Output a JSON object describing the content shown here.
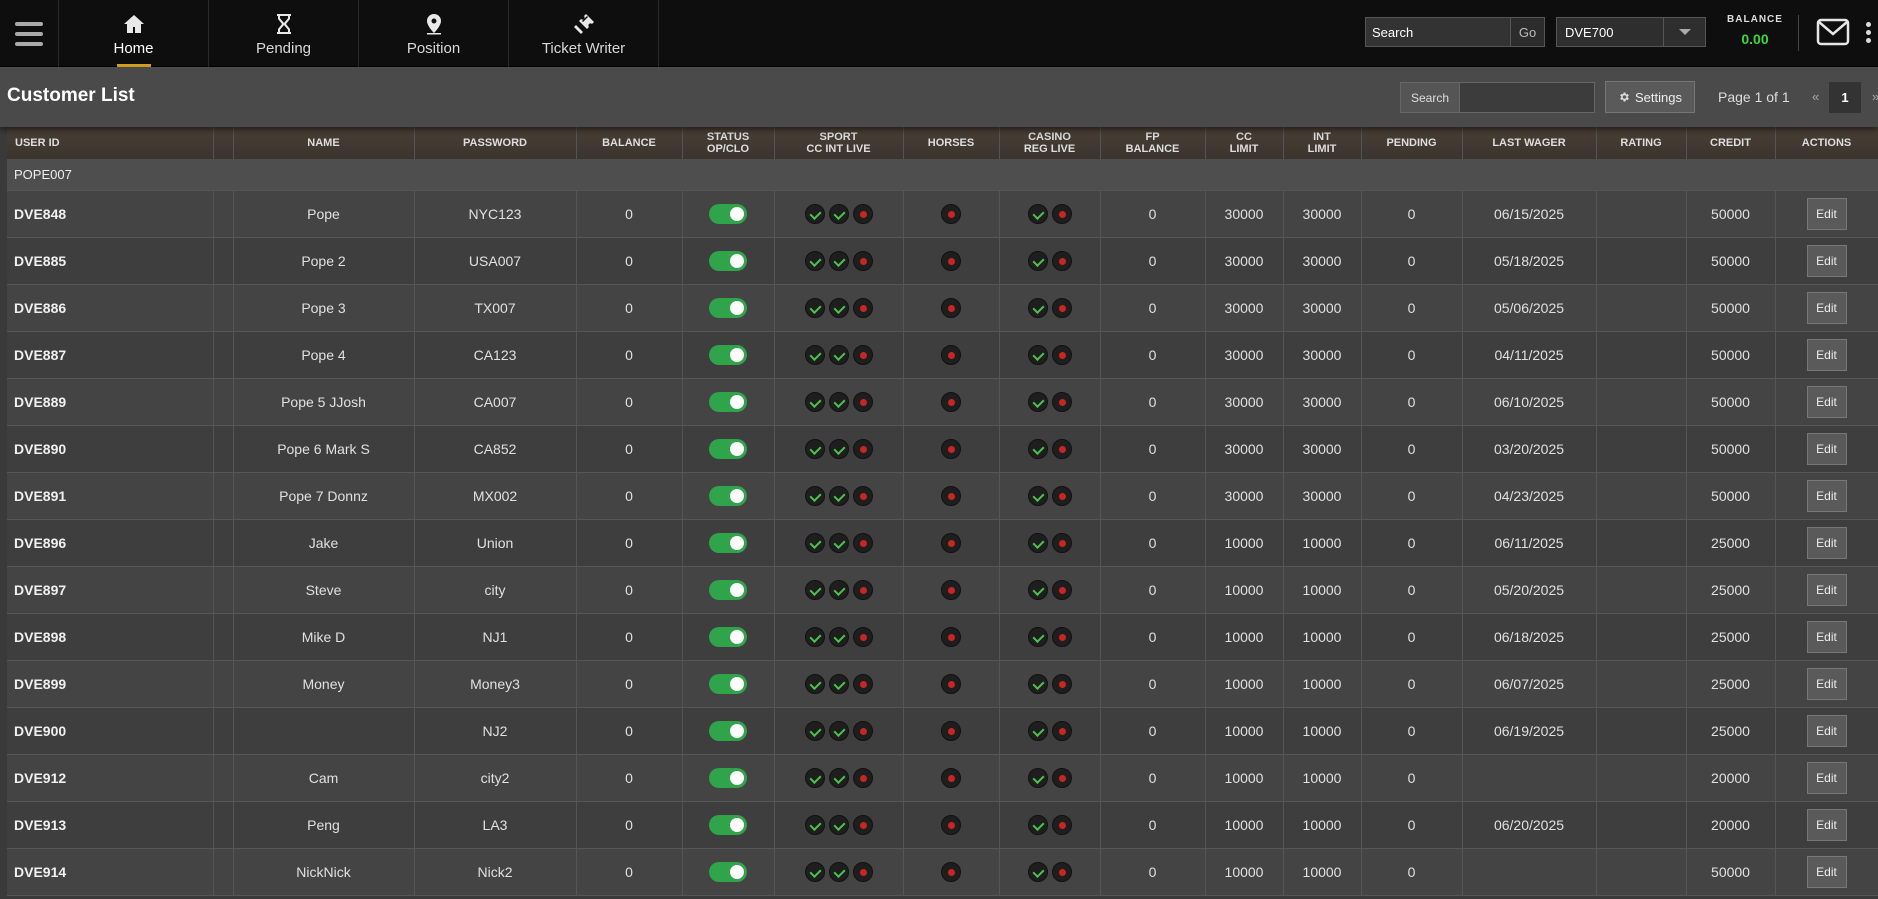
{
  "nav": {
    "tabs": [
      {
        "label": "Home",
        "icon": "home-icon"
      },
      {
        "label": "Pending",
        "icon": "hourglass-icon"
      },
      {
        "label": "Position",
        "icon": "map-pin-icon"
      },
      {
        "label": "Ticket Writer",
        "icon": "ticket-icon"
      }
    ],
    "active_tab": "Home",
    "search_value": "Search",
    "go_label": "Go",
    "account_selected": "DVE700",
    "balance_label": "BALANCE",
    "balance_value": "0.00"
  },
  "colors": {
    "accent": "#d9a321",
    "balance": "#3fd63f",
    "toggle_on": "#2fa44a",
    "check": "#4cc24c",
    "cross": "#c92525"
  },
  "titlebar": {
    "title": "Customer List",
    "search_label": "Search",
    "search_value": "",
    "settings_label": "Settings",
    "page_info": "Page 1 of 1",
    "prev": "«",
    "current_page": "1",
    "next": "»"
  },
  "table": {
    "headers": [
      "USER ID",
      "",
      "NAME",
      "PASSWORD",
      "BALANCE",
      "STATUS\nOP/CLO",
      "SPORT\nCC INT LIVE",
      "HORSES",
      "CASINO\nREG LIVE",
      "FP\nBALANCE",
      "CC\nLIMIT",
      "INT\nLIMIT",
      "PENDING",
      "LAST WAGER",
      "RATING",
      "CREDIT",
      "ACTIONS"
    ],
    "group": "POPE007",
    "edit_label": "Edit",
    "rows": [
      {
        "uid": "DVE848",
        "name": "Pope",
        "password": "NYC123",
        "balance": "0",
        "fp": "0",
        "cc": "30000",
        "int": "30000",
        "pending": "0",
        "last": "06/15/2025",
        "rating": "",
        "credit": "50000"
      },
      {
        "uid": "DVE885",
        "name": "Pope 2",
        "password": "USA007",
        "balance": "0",
        "fp": "0",
        "cc": "30000",
        "int": "30000",
        "pending": "0",
        "last": "05/18/2025",
        "rating": "",
        "credit": "50000"
      },
      {
        "uid": "DVE886",
        "name": "Pope 3",
        "password": "TX007",
        "balance": "0",
        "fp": "0",
        "cc": "30000",
        "int": "30000",
        "pending": "0",
        "last": "05/06/2025",
        "rating": "",
        "credit": "50000"
      },
      {
        "uid": "DVE887",
        "name": "Pope 4",
        "password": "CA123",
        "balance": "0",
        "fp": "0",
        "cc": "30000",
        "int": "30000",
        "pending": "0",
        "last": "04/11/2025",
        "rating": "",
        "credit": "50000"
      },
      {
        "uid": "DVE889",
        "name": "Pope 5 JJosh",
        "password": "CA007",
        "balance": "0",
        "fp": "0",
        "cc": "30000",
        "int": "30000",
        "pending": "0",
        "last": "06/10/2025",
        "rating": "",
        "credit": "50000"
      },
      {
        "uid": "DVE890",
        "name": "Pope 6 Mark S",
        "password": "CA852",
        "balance": "0",
        "fp": "0",
        "cc": "30000",
        "int": "30000",
        "pending": "0",
        "last": "03/20/2025",
        "rating": "",
        "credit": "50000"
      },
      {
        "uid": "DVE891",
        "name": "Pope 7 Donnz",
        "password": "MX002",
        "balance": "0",
        "fp": "0",
        "cc": "30000",
        "int": "30000",
        "pending": "0",
        "last": "04/23/2025",
        "rating": "",
        "credit": "50000"
      },
      {
        "uid": "DVE896",
        "name": "Jake",
        "password": "Union",
        "balance": "0",
        "fp": "0",
        "cc": "10000",
        "int": "10000",
        "pending": "0",
        "last": "06/11/2025",
        "rating": "",
        "credit": "25000"
      },
      {
        "uid": "DVE897",
        "name": "Steve",
        "password": "city",
        "balance": "0",
        "fp": "0",
        "cc": "10000",
        "int": "10000",
        "pending": "0",
        "last": "05/20/2025",
        "rating": "",
        "credit": "25000"
      },
      {
        "uid": "DVE898",
        "name": "Mike D",
        "password": "NJ1",
        "balance": "0",
        "fp": "0",
        "cc": "10000",
        "int": "10000",
        "pending": "0",
        "last": "06/18/2025",
        "rating": "",
        "credit": "25000"
      },
      {
        "uid": "DVE899",
        "name": "Money",
        "password": "Money3",
        "balance": "0",
        "fp": "0",
        "cc": "10000",
        "int": "10000",
        "pending": "0",
        "last": "06/07/2025",
        "rating": "",
        "credit": "25000"
      },
      {
        "uid": "DVE900",
        "name": "",
        "password": "NJ2",
        "balance": "0",
        "fp": "0",
        "cc": "10000",
        "int": "10000",
        "pending": "0",
        "last": "06/19/2025",
        "rating": "",
        "credit": "25000"
      },
      {
        "uid": "DVE912",
        "name": "Cam",
        "password": "city2",
        "balance": "0",
        "fp": "0",
        "cc": "10000",
        "int": "10000",
        "pending": "0",
        "last": "",
        "rating": "",
        "credit": "20000"
      },
      {
        "uid": "DVE913",
        "name": "Peng",
        "password": "LA3",
        "balance": "0",
        "fp": "0",
        "cc": "10000",
        "int": "10000",
        "pending": "0",
        "last": "06/20/2025",
        "rating": "",
        "credit": "20000"
      },
      {
        "uid": "DVE914",
        "name": "NickNick",
        "password": "Nick2",
        "balance": "0",
        "fp": "0",
        "cc": "10000",
        "int": "10000",
        "pending": "0",
        "last": "",
        "rating": "",
        "credit": "50000"
      }
    ]
  }
}
